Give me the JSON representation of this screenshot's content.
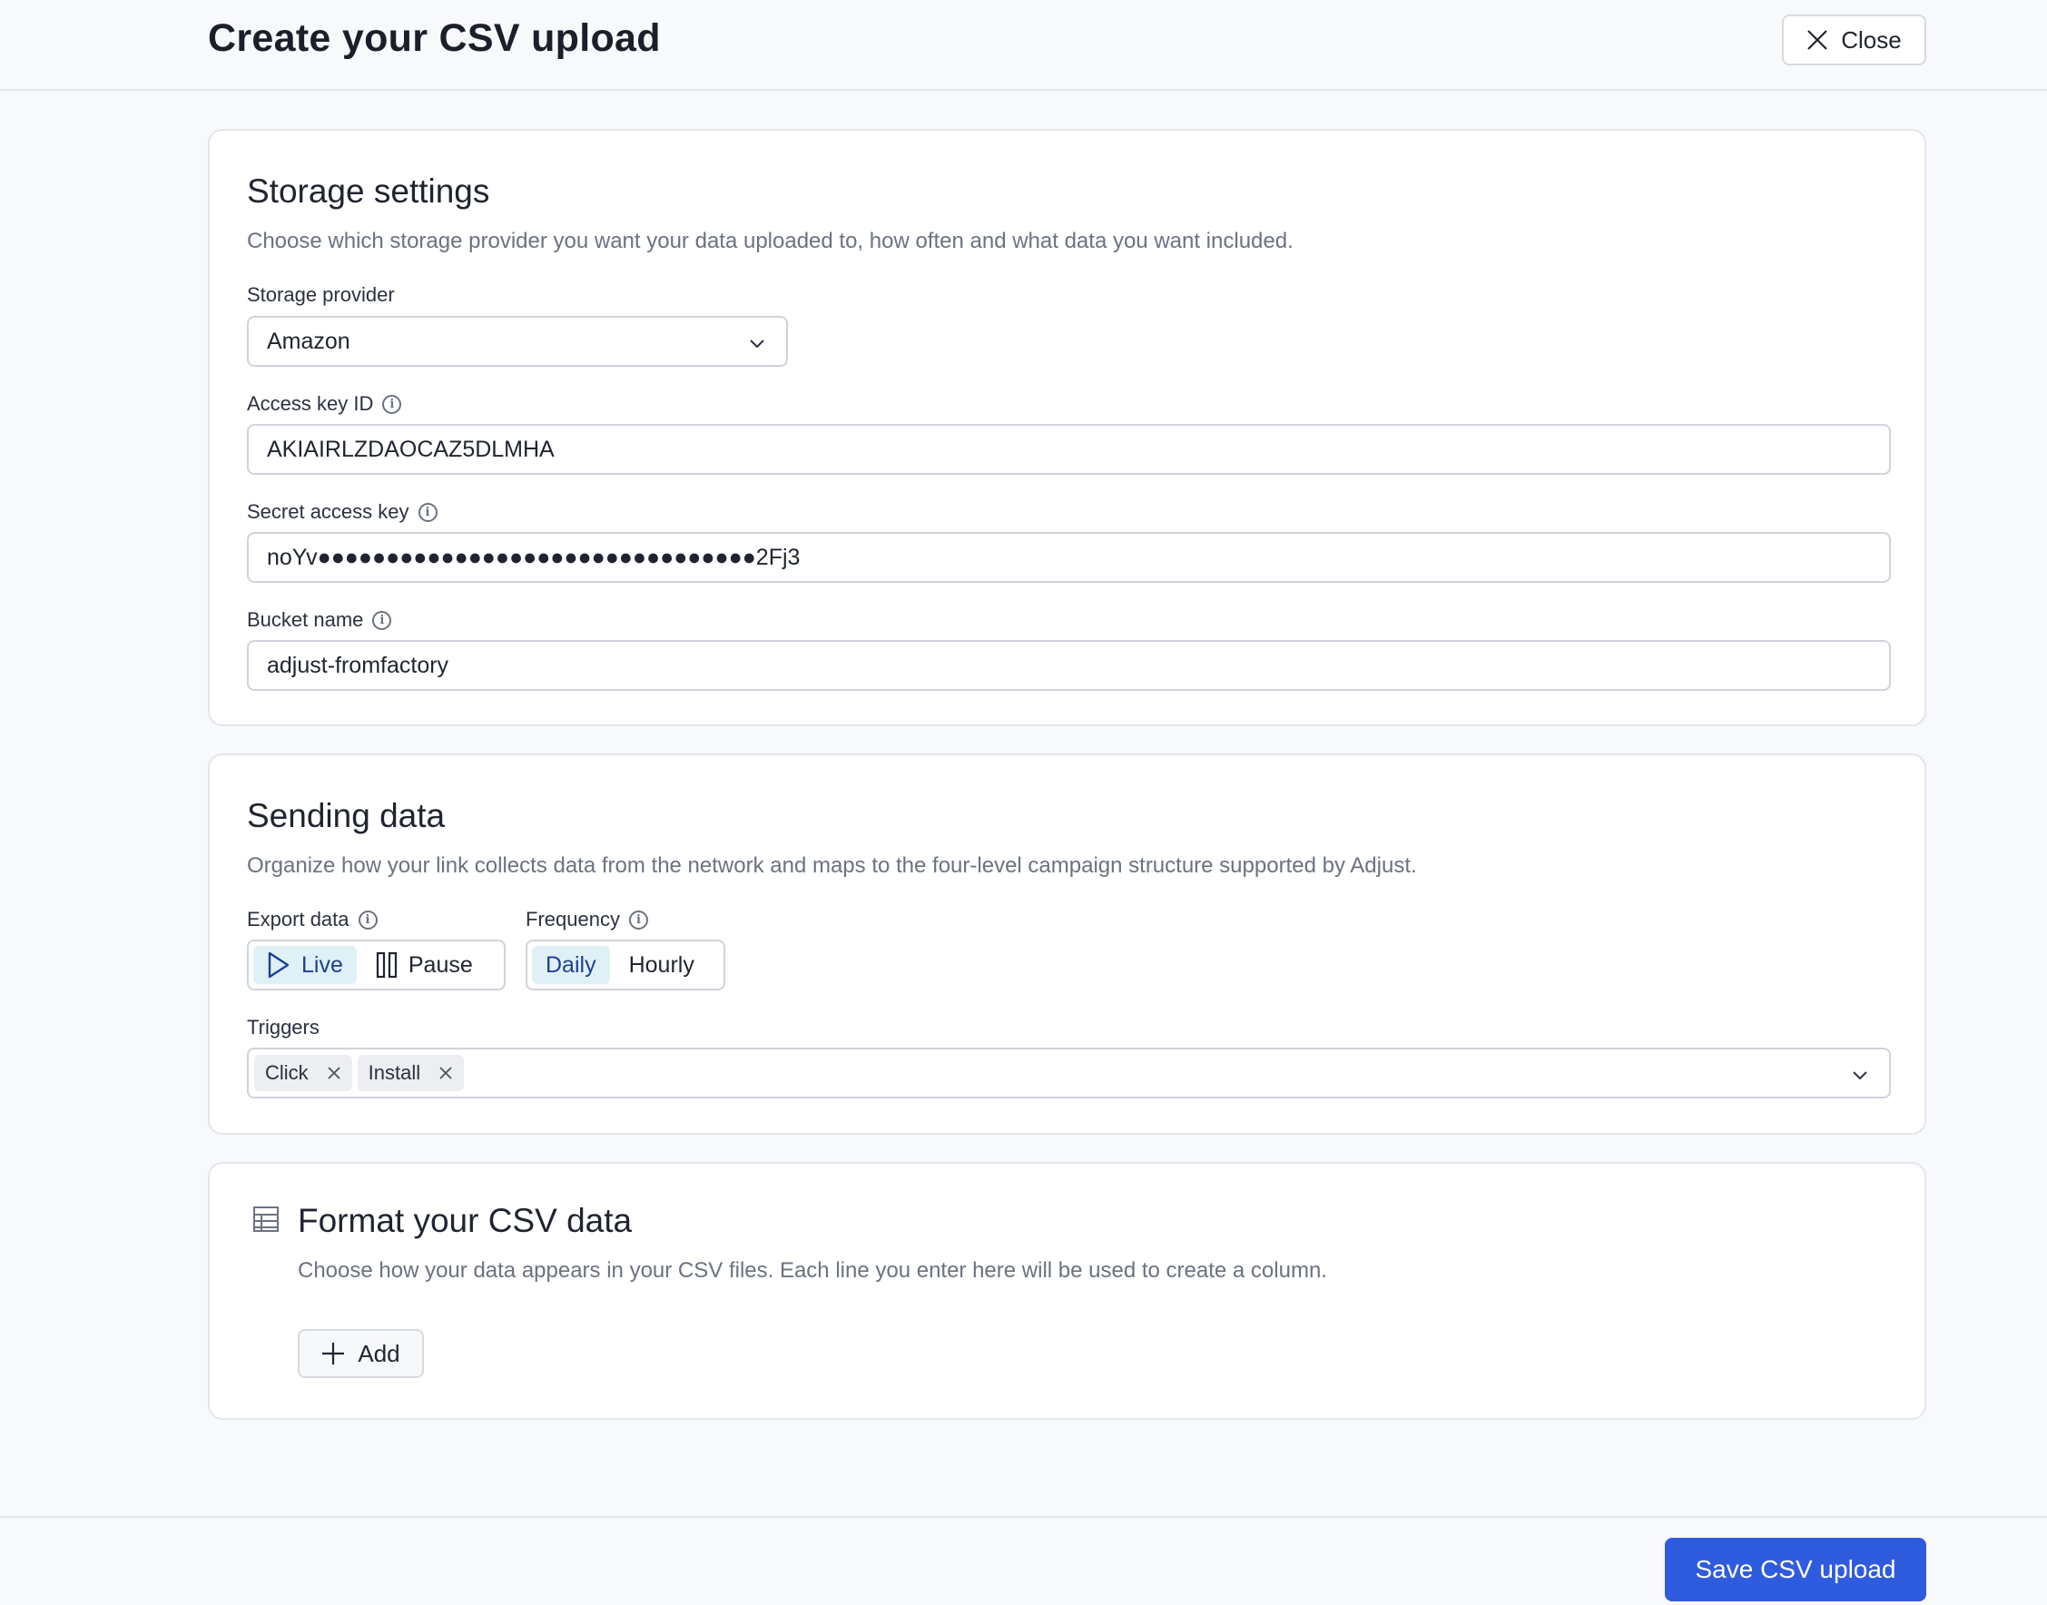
{
  "header": {
    "title": "Create your CSV upload",
    "close_label": "Close"
  },
  "storage": {
    "title": "Storage settings",
    "description": "Choose which storage provider you want your data uploaded to, how often and what data you want included.",
    "provider_label": "Storage provider",
    "provider_value": "Amazon",
    "access_key_label": "Access key ID",
    "access_key_value": "AKIAIRLZDAOCAZ5DLMHA",
    "secret_label": "Secret access key",
    "secret_value": "noYv●●●●●●●●●●●●●●●●●●●●●●●●●●●●●●●●2Fj3",
    "bucket_label": "Bucket name",
    "bucket_value": "adjust-fromfactory"
  },
  "sending": {
    "title": "Sending data",
    "description": "Organize how your link collects data from the network and maps to the four-level campaign structure supported by Adjust.",
    "export_label": "Export data",
    "export_options": [
      "Live",
      "Pause"
    ],
    "export_selected": "Live",
    "frequency_label": "Frequency",
    "frequency_options": [
      "Daily",
      "Hourly"
    ],
    "frequency_selected": "Daily",
    "triggers_label": "Triggers",
    "triggers": [
      "Click",
      "Install"
    ]
  },
  "format": {
    "title": "Format your CSV data",
    "description": "Choose how your data appears in your CSV files. Each line you enter here will be used to create a column.",
    "add_label": "Add"
  },
  "footer": {
    "save_label": "Save CSV upload"
  },
  "colors": {
    "accent": "#2f5bde",
    "active_segment": "#dff1f7",
    "active_text": "#1d3f93"
  },
  "icons": [
    "close-icon",
    "chevron-down-icon",
    "info-icon",
    "play-icon",
    "pause-icon",
    "table-icon",
    "plus-icon"
  ]
}
